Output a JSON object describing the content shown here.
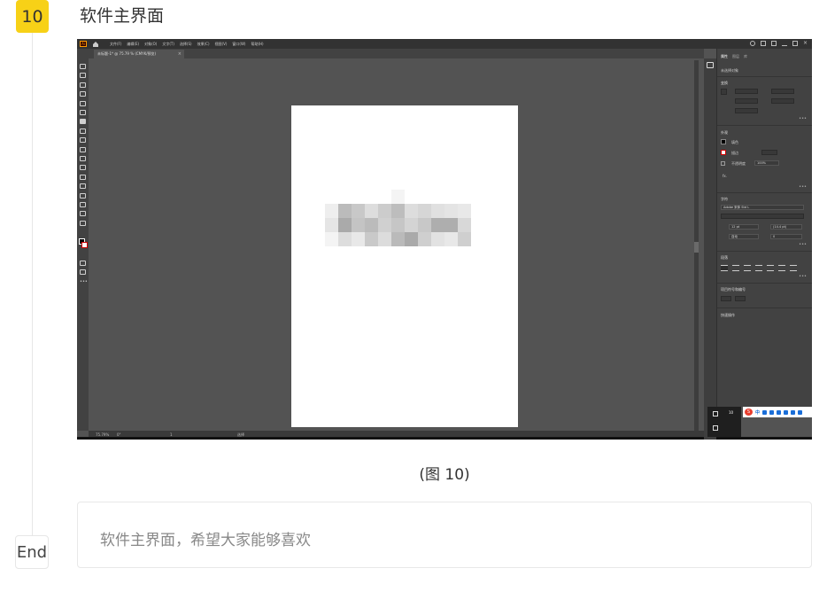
{
  "step": {
    "number": "10",
    "title": "软件主界面"
  },
  "app": {
    "logo_text": "Ai",
    "menu": [
      "文件(F)",
      "编辑(E)",
      "对象(O)",
      "文字(T)",
      "选择(S)",
      "效果(C)",
      "视图(V)",
      "窗口(W)",
      "帮助(H)"
    ],
    "document_tab": "未标题-1* @ 75.79 % (CMYK/预览)",
    "document_tab_close": "×",
    "status": {
      "zoom": "75.79%",
      "angle": "0°",
      "page": "1",
      "tool": "选择"
    },
    "properties_panel": {
      "tabs": [
        "属性",
        "图层",
        "库"
      ],
      "no_selection": "未选择对象",
      "transform_heading": "变换",
      "appearance_heading": "外观",
      "fill_label": "填色",
      "stroke_label": "描边",
      "opacity_label": "不透明度",
      "opacity_value": "100%",
      "fx_label": "fx.",
      "character_heading": "字符",
      "font_name": "Adobe 宋体 Std L",
      "font_size": "12 pt",
      "leading": "(14.4 pt)",
      "tracking": "自动",
      "kerning": "0",
      "paragraph_heading": "段落",
      "bullets_heading": "项目符号和编号",
      "quick_actions_heading": "快速操作",
      "more": "•••"
    },
    "notification_count": "10",
    "ime": {
      "logo": "S",
      "mode": "中"
    }
  },
  "caption": "(图 10)",
  "note": "软件主界面，希望大家能够喜欢",
  "end_label": "End",
  "colors": {
    "badge": "#f7d117",
    "canvas": "#535353",
    "panel": "#424242",
    "menubar": "#323232"
  }
}
